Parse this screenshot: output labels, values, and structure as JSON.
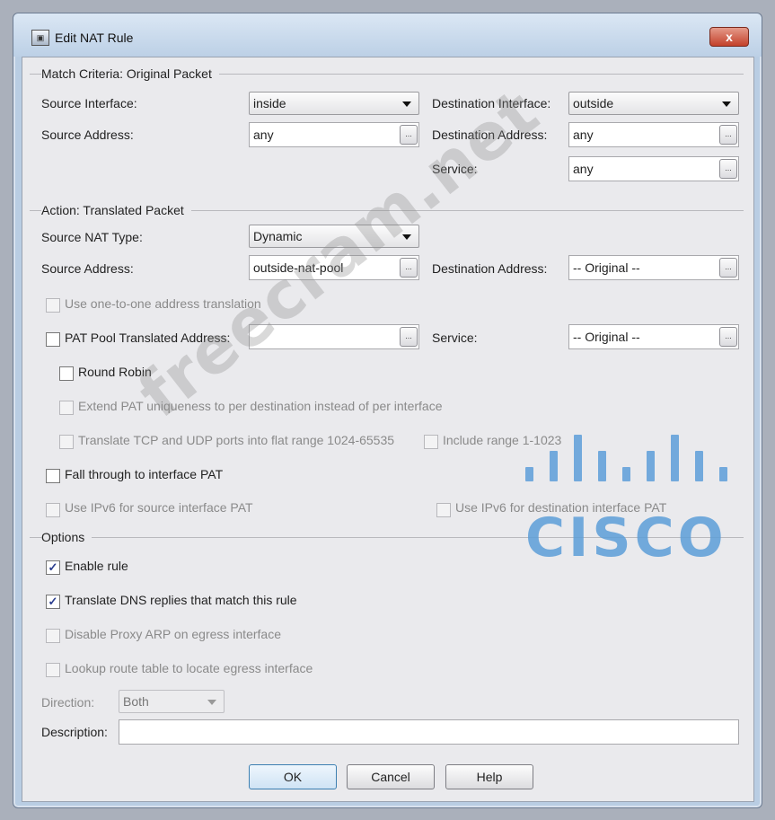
{
  "window": {
    "title": "Edit NAT Rule",
    "close_label": "x"
  },
  "match": {
    "section_title": "Match Criteria: Original Packet",
    "source_interface_label": "Source Interface:",
    "source_interface_value": "inside",
    "destination_interface_label": "Destination Interface:",
    "destination_interface_value": "outside",
    "source_address_label": "Source Address:",
    "source_address_value": "any",
    "destination_address_label": "Destination Address:",
    "destination_address_value": "any",
    "service_label": "Service:",
    "service_value": "any"
  },
  "action": {
    "section_title": "Action: Translated Packet",
    "source_nat_type_label": "Source NAT Type:",
    "source_nat_type_value": "Dynamic",
    "source_address_label": "Source Address:",
    "source_address_value": "outside-nat-pool",
    "destination_address_label": "Destination Address:",
    "destination_address_value": "-- Original --",
    "one_to_one_label": "Use one-to-one address translation",
    "pat_pool_label": "PAT Pool Translated Address:",
    "pat_pool_value": "",
    "service_label": "Service:",
    "service_value": "-- Original --",
    "round_robin_label": "Round Robin",
    "extend_pat_label": "Extend PAT uniqueness to per destination instead of per interface",
    "translate_ports_label": "Translate TCP and UDP ports into flat range 1024-65535",
    "include_range_label": "Include range 1-1023",
    "fall_through_label": "Fall through to interface PAT",
    "ipv6_source_label": "Use IPv6 for source interface PAT",
    "ipv6_destination_label": "Use IPv6 for destination interface PAT"
  },
  "options": {
    "section_title": "Options",
    "enable_rule_label": "Enable rule",
    "enable_rule_checked": true,
    "translate_dns_label": "Translate DNS replies that match this rule",
    "translate_dns_checked": true,
    "disable_proxy_arp_label": "Disable Proxy ARP on egress interface",
    "lookup_route_label": "Lookup route table to locate egress interface",
    "direction_label": "Direction:",
    "direction_value": "Both",
    "description_label": "Description:",
    "description_value": ""
  },
  "buttons": {
    "ok": "OK",
    "cancel": "Cancel",
    "help": "Help"
  },
  "check_glyph": "✓",
  "watermark": {
    "text": "freecram.net",
    "logo_text": "CISCO"
  },
  "colors": {
    "accent": "#5d9ed8",
    "checkbox_mark": "#2a3d8f"
  }
}
